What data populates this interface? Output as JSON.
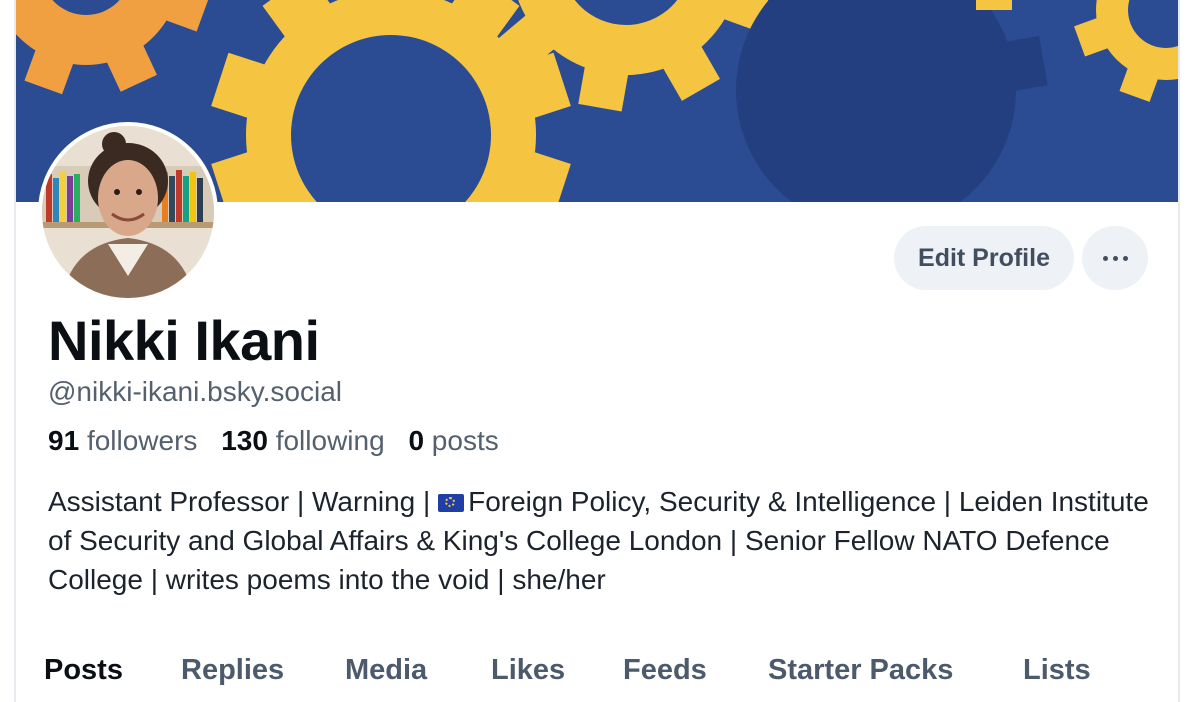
{
  "profile": {
    "display_name": "Nikki Ikani",
    "handle": "@nikki-ikani.bsky.social",
    "followers_count": "91",
    "followers_label": "followers",
    "following_count": "130",
    "following_label": "following",
    "posts_count": "0",
    "posts_label": "posts",
    "bio_part1": "Assistant Professor | Warning | ",
    "bio_part2": "Foreign Policy, Security & Intelligence | Leiden Institute of Security and Global Affairs & King's College London | Senior Fellow NATO Defence College | writes poems into the void | she/her"
  },
  "actions": {
    "edit_label": "Edit Profile",
    "more_icon": "ellipsis-icon"
  },
  "tabs": [
    {
      "label": "Posts",
      "active": true
    },
    {
      "label": "Replies"
    },
    {
      "label": "Media"
    },
    {
      "label": "Likes"
    },
    {
      "label": "Feeds"
    },
    {
      "label": "Starter Packs"
    },
    {
      "label": "Lists"
    }
  ],
  "colors": {
    "banner_blue": "#2b4c93",
    "gear_yellow": "#f5c542",
    "gear_orange": "#f0a040",
    "button_bg": "#eef1f5"
  }
}
